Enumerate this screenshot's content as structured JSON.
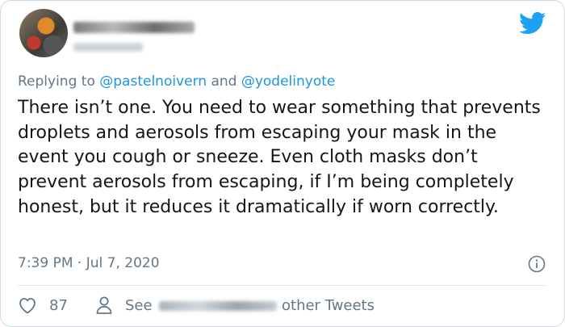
{
  "tweet": {
    "reply_prefix": "Replying to",
    "mention_1": "@pastelnoivern",
    "reply_and": "and",
    "mention_2": "@yodelinyote",
    "text": "There isn’t one. You need to wear something that prevents droplets and aerosols from escaping your mask in the event you cough or sneeze. Even cloth masks don’t prevent aerosols from escaping, if I’m being completely honest, but it reduces it dramatically if worn correctly.",
    "timestamp": "7:39 PM · Jul 7, 2020"
  },
  "actions": {
    "like_count": "87",
    "see_label": "See",
    "other_label": "other Tweets"
  },
  "colors": {
    "twitter_blue": "#1da1f2",
    "link_blue": "#1b95e0",
    "muted_gray": "#657786",
    "text_dark": "#14171a"
  },
  "icons": [
    "twitter-bird-icon",
    "info-icon",
    "heart-icon",
    "person-icon"
  ]
}
